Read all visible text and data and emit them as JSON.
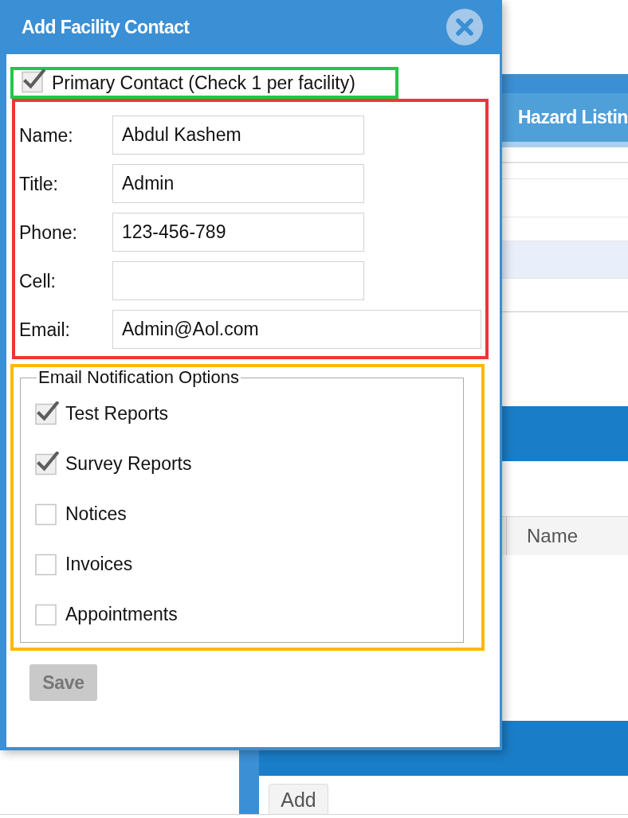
{
  "background_page": {
    "panel_title": "Hazard Listin",
    "rows": [
      {
        "selected": false
      },
      {
        "selected": false
      },
      {
        "selected": false
      },
      {
        "selected": true
      },
      {
        "selected": false
      }
    ],
    "table": {
      "columns": [
        "Name"
      ]
    },
    "notes": {
      "add_button": "Add"
    }
  },
  "dialog": {
    "title": "Add Facility Contact",
    "primary_contact": {
      "label": "Primary Contact (Check 1 per facility)",
      "checked": true
    },
    "fields": [
      {
        "label": "Name:",
        "value": "Abdul Kashem",
        "kind": "short"
      },
      {
        "label": "Title:",
        "value": "Admin",
        "kind": "short"
      },
      {
        "label": "Phone:",
        "value": "123-456-789",
        "kind": "short"
      },
      {
        "label": "Cell:",
        "kind": "short"
      },
      {
        "label": "Email:",
        "value": "Admin@Aol.com",
        "kind": "wide"
      }
    ],
    "notifications": {
      "legend": "Email Notification Options",
      "options": [
        {
          "label": "Test Reports",
          "checked": true
        },
        {
          "label": "Survey Reports",
          "checked": true
        },
        {
          "label": "Notices",
          "checked": false
        },
        {
          "label": "Invoices",
          "checked": false
        },
        {
          "label": "Appointments",
          "checked": false
        }
      ]
    },
    "save_button": {
      "label": "Save",
      "disabled": true
    }
  }
}
